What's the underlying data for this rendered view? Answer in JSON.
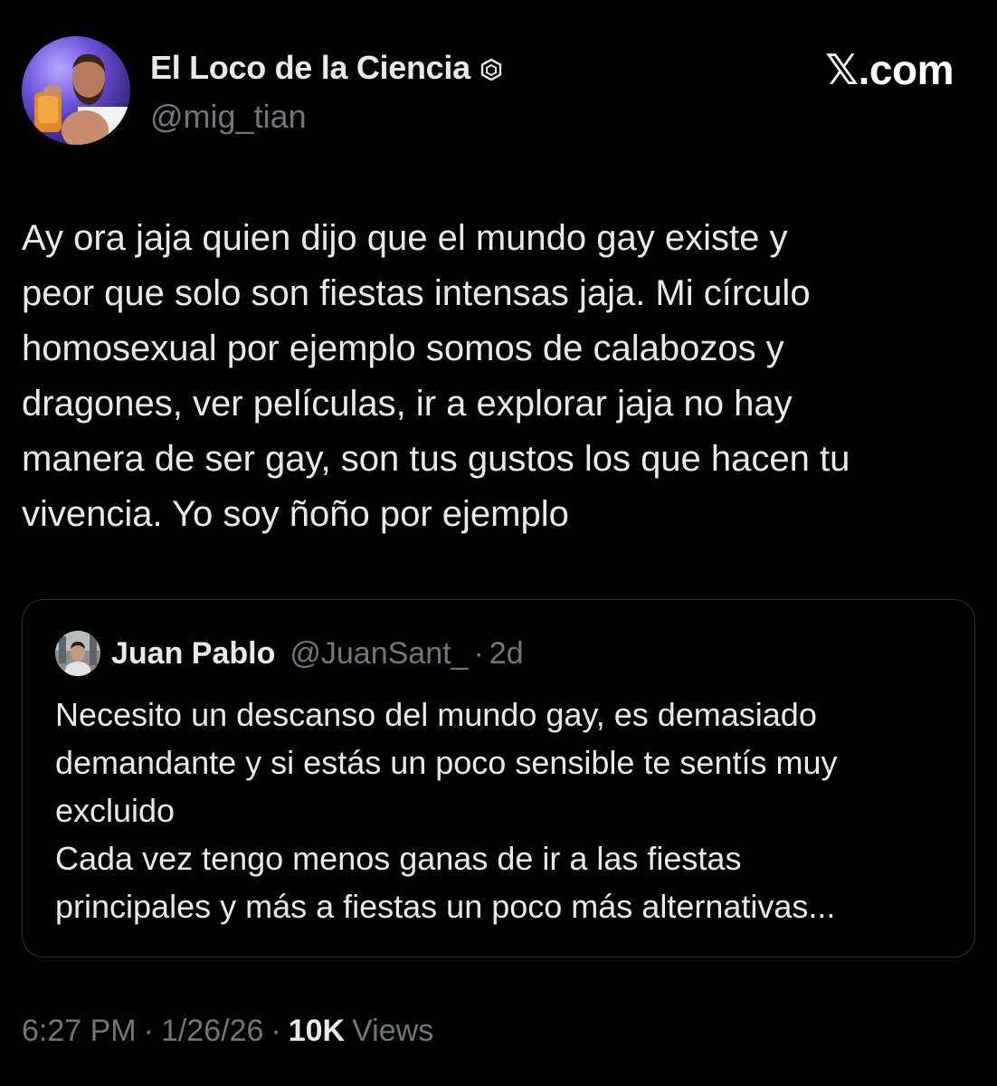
{
  "tweet": {
    "author": {
      "name": "El Loco de la Ciencia",
      "handle": "@mig_tian"
    },
    "brand": "𝕏.com",
    "text": "Ay ora jaja quien dijo que el mundo gay existe y\npeor que solo son fiestas intensas jaja. Mi círculo\nhomosexual por ejemplo somos de calabozos y\ndragones, ver películas, ir a explorar jaja no hay\nmanera de ser gay, son tus gustos los que hacen tu\nvivencia. Yo soy ñoño por ejemplo",
    "quote": {
      "author_name": "Juan Pablo",
      "author_handle": "@JuanSant_",
      "separator": "·",
      "time_ago": "2d",
      "text": "Necesito un descanso del mundo gay, es demasiado\ndemandante y si estás un poco sensible te sentís muy\nexcluido\nCada vez tengo menos ganas de ir a las fiestas\nprincipales y más a fiestas un poco más alternativas..."
    },
    "meta": {
      "time": "6:27 PM",
      "separator": "·",
      "date": "1/26/26",
      "views_count": "10K",
      "views_label": "Views"
    }
  },
  "colors": {
    "background": "#000000",
    "text_primary": "#e7e9ea",
    "text_secondary": "#71767b",
    "border": "#2f3336"
  },
  "icons": {
    "badge": "hexagon-badge-icon"
  }
}
